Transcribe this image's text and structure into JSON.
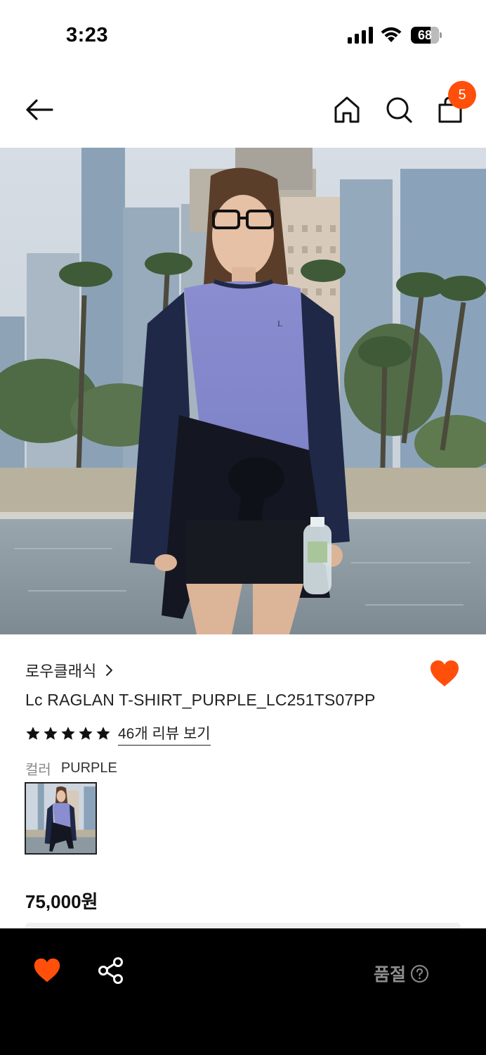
{
  "status_bar": {
    "time": "3:23",
    "battery": "68"
  },
  "nav": {
    "back_icon": "arrow-left-icon",
    "home_icon": "home-icon",
    "search_icon": "search-icon",
    "cart_icon": "shopping-bag-icon",
    "cart_count": "5"
  },
  "product": {
    "brand": "로우클래식",
    "title": "Lc RAGLAN T-SHIRT_PURPLE_LC251TS07PP",
    "rating_stars": 5,
    "review_link": "46개 리뷰 보기",
    "color_label": "컬러",
    "color_value": "PURPLE",
    "price": "75,000원"
  },
  "bottom_bar": {
    "soldout_label": "품절",
    "heart_icon": "heart-icon",
    "share_icon": "share-icon",
    "help_icon": "question-circle-icon"
  },
  "colors": {
    "accent": "#ff4f0a",
    "bottom_bar_bg": "#000000",
    "soldout_text": "#8c8c8c"
  }
}
